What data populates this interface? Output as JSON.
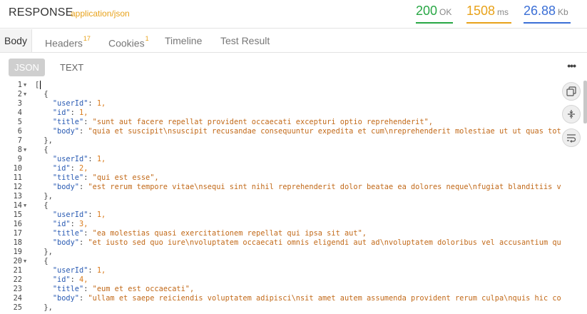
{
  "header": {
    "title": "RESPONSE",
    "content_type": "application/json",
    "status": {
      "value": "200",
      "unit": "OK",
      "color": "#28a745"
    },
    "time": {
      "value": "1508",
      "unit": "ms",
      "color": "#e8a21a"
    },
    "size": {
      "value": "26.88",
      "unit": "Kb",
      "color": "#3b6fd6"
    }
  },
  "tabs": {
    "body": "Body",
    "headers": "Headers",
    "headers_count": "17",
    "cookies": "Cookies",
    "cookies_count": "1",
    "timeline": "Timeline",
    "test_result": "Test Result"
  },
  "format": {
    "json": "JSON",
    "text": "TEXT",
    "more": "•••"
  },
  "editor": {
    "lines": [
      {
        "n": "1",
        "fold": true,
        "t": "[",
        "cursor": true
      },
      {
        "n": "2",
        "fold": true,
        "t": "  {"
      },
      {
        "n": "3",
        "fold": false,
        "key": "userId",
        "val": "1,",
        "vtype": "n"
      },
      {
        "n": "4",
        "fold": false,
        "key": "id",
        "val": "1,",
        "vtype": "n"
      },
      {
        "n": "5",
        "fold": false,
        "key": "title",
        "val": "\"sunt aut facere repellat provident occaecati excepturi optio reprehenderit\",",
        "vtype": "s"
      },
      {
        "n": "6",
        "fold": false,
        "key": "body",
        "val": "\"quia et suscipit\\nsuscipit recusandae consequuntur expedita et cum\\nreprehenderit molestiae ut ut quas tot",
        "vtype": "s"
      },
      {
        "n": "7",
        "fold": false,
        "t": "  },"
      },
      {
        "n": "8",
        "fold": true,
        "t": "  {"
      },
      {
        "n": "9",
        "fold": false,
        "key": "userId",
        "val": "1,",
        "vtype": "n"
      },
      {
        "n": "10",
        "fold": false,
        "key": "id",
        "val": "2,",
        "vtype": "n"
      },
      {
        "n": "11",
        "fold": false,
        "key": "title",
        "val": "\"qui est esse\",",
        "vtype": "s"
      },
      {
        "n": "12",
        "fold": false,
        "key": "body",
        "val": "\"est rerum tempore vitae\\nsequi sint nihil reprehenderit dolor beatae ea dolores neque\\nfugiat blanditiis v",
        "vtype": "s"
      },
      {
        "n": "13",
        "fold": false,
        "t": "  },"
      },
      {
        "n": "14",
        "fold": true,
        "t": "  {"
      },
      {
        "n": "15",
        "fold": false,
        "key": "userId",
        "val": "1,",
        "vtype": "n"
      },
      {
        "n": "16",
        "fold": false,
        "key": "id",
        "val": "3,",
        "vtype": "n"
      },
      {
        "n": "17",
        "fold": false,
        "key": "title",
        "val": "\"ea molestias quasi exercitationem repellat qui ipsa sit aut\",",
        "vtype": "s"
      },
      {
        "n": "18",
        "fold": false,
        "key": "body",
        "val": "\"et iusto sed quo iure\\nvoluptatem occaecati omnis eligendi aut ad\\nvoluptatem doloribus vel accusantium qu",
        "vtype": "s"
      },
      {
        "n": "19",
        "fold": false,
        "t": "  },"
      },
      {
        "n": "20",
        "fold": true,
        "t": "  {"
      },
      {
        "n": "21",
        "fold": false,
        "key": "userId",
        "val": "1,",
        "vtype": "n"
      },
      {
        "n": "22",
        "fold": false,
        "key": "id",
        "val": "4,",
        "vtype": "n"
      },
      {
        "n": "23",
        "fold": false,
        "key": "title",
        "val": "\"eum et est occaecati\",",
        "vtype": "s"
      },
      {
        "n": "24",
        "fold": false,
        "key": "body",
        "val": "\"ullam et saepe reiciendis voluptatem adipisci\\nsit amet autem assumenda provident rerum culpa\\nquis hic co",
        "vtype": "s"
      },
      {
        "n": "25",
        "fold": false,
        "t": "  },"
      }
    ]
  },
  "controls": [
    "copy-icon",
    "beautify-icon",
    "wrap-icon"
  ]
}
